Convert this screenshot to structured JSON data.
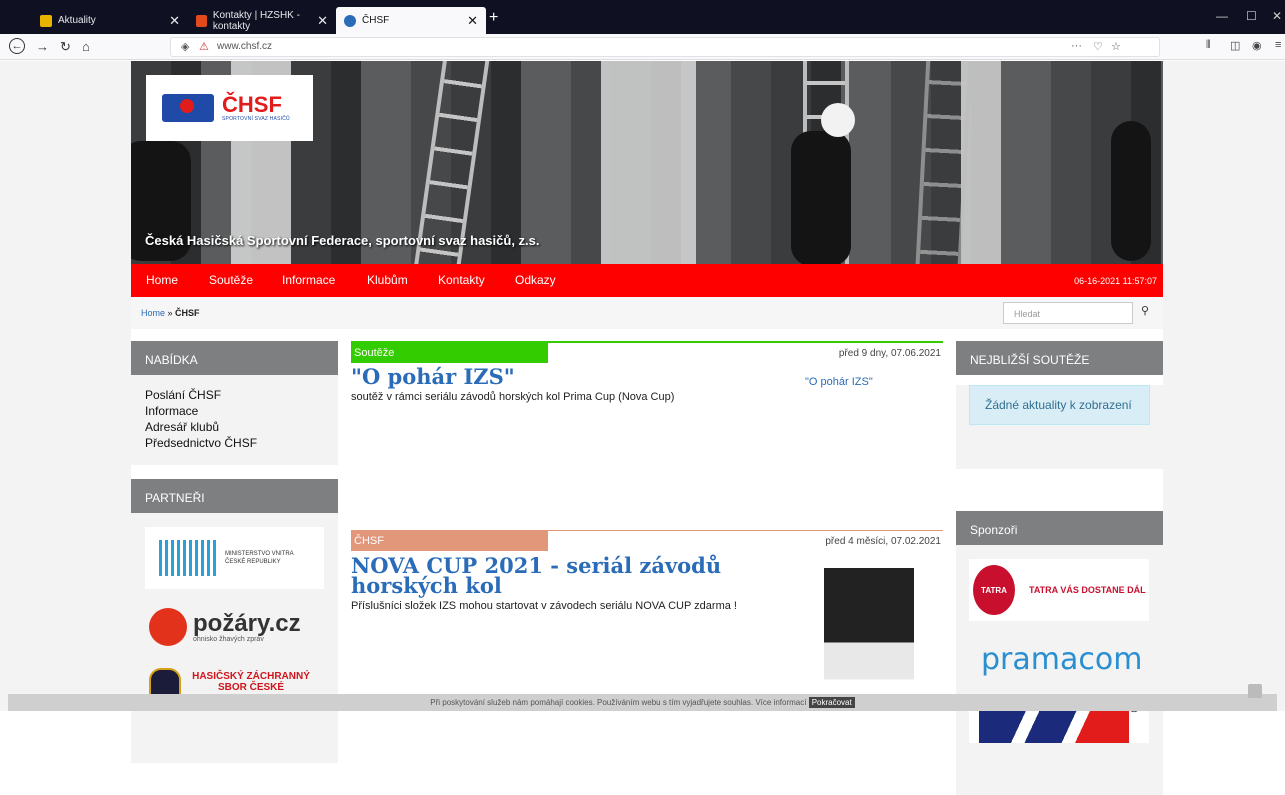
{
  "browser": {
    "tabs": [
      {
        "label": "Aktuality",
        "active": false
      },
      {
        "label": "Kontakty | HZSHK - kontakty",
        "active": false
      },
      {
        "label": "ČHSF",
        "active": true
      }
    ],
    "url": "www.chsf.cz"
  },
  "site": {
    "logo_text": "ČHSF",
    "logo_subtext": "SPORTOVNÍ SVAZ HASIČŮ",
    "tagline": "Česká Hasičská Sportovní Federace, sportovní svaz hasičů, z.s.",
    "menu": [
      "Home",
      "Soutěže",
      "Informace",
      "Klubům",
      "Kontakty",
      "Odkazy"
    ],
    "clock": "06-16-2021 11:57:07",
    "breadcrumb": {
      "home": "Home",
      "sep": " » ",
      "current": "ČHSF"
    },
    "search_placeholder": "Hledat"
  },
  "left": {
    "nabidka_title": "NABÍDKA",
    "nabidka_items": [
      "Poslání ČHSF",
      "Informace",
      "Adresář klubů",
      "Předsednictvo ČHSF"
    ],
    "partneri_title": "PARTNEŘI",
    "partners": [
      {
        "name": "MINISTERSTVO VNITRA ČESKÉ REPUBLIKY"
      },
      {
        "name": "požáry.cz",
        "sub": "ohnisko žhavých zpráv"
      },
      {
        "name": "HASIČSKÝ ZÁCHRANNÝ SBOR ČESKÉ REPUBLIKY"
      }
    ]
  },
  "articles": [
    {
      "category": "Soutěže",
      "category_color": "#33cc00",
      "date": "před 9 dny, 07.06.2021",
      "title": "\"O pohár IZS\"",
      "text": "soutěž v rámci seriálu závodů horských kol Prima Cup (Nova Cup)",
      "side_link": "\"O pohár IZS\""
    },
    {
      "category": "ČHSF",
      "category_color": "#e2967a",
      "date": "před 4 měsíci, 07.02.2021",
      "title": "NOVA CUP 2021 - seriál závodů horských kol",
      "text": "Příslušníci složek IZS mohou startovat v závodech seriálu NOVA CUP zdarma !"
    }
  ],
  "right": {
    "nearest_title": "NEJBLIŽŠÍ SOUTĚŽE",
    "no_news": "Žádné aktuality k zobrazení",
    "sponsors_title": "Sponzoři",
    "sponsors": [
      {
        "name": "TATRA VÁS DOSTANE DÁL",
        "mark": "TATRA"
      },
      {
        "name": "pramacom"
      },
      {
        "name": "®"
      }
    ]
  },
  "cookie": {
    "text": "Při poskytování služeb nám pomáhají cookies. Používáním webu s tím vyjadřujete souhlas.",
    "more": "Více informací",
    "button": "Pokračovat"
  },
  "colors": {
    "menu_red": "#fe0000",
    "link_blue": "#2a6cb8",
    "box_grey": "#7d7f80"
  }
}
